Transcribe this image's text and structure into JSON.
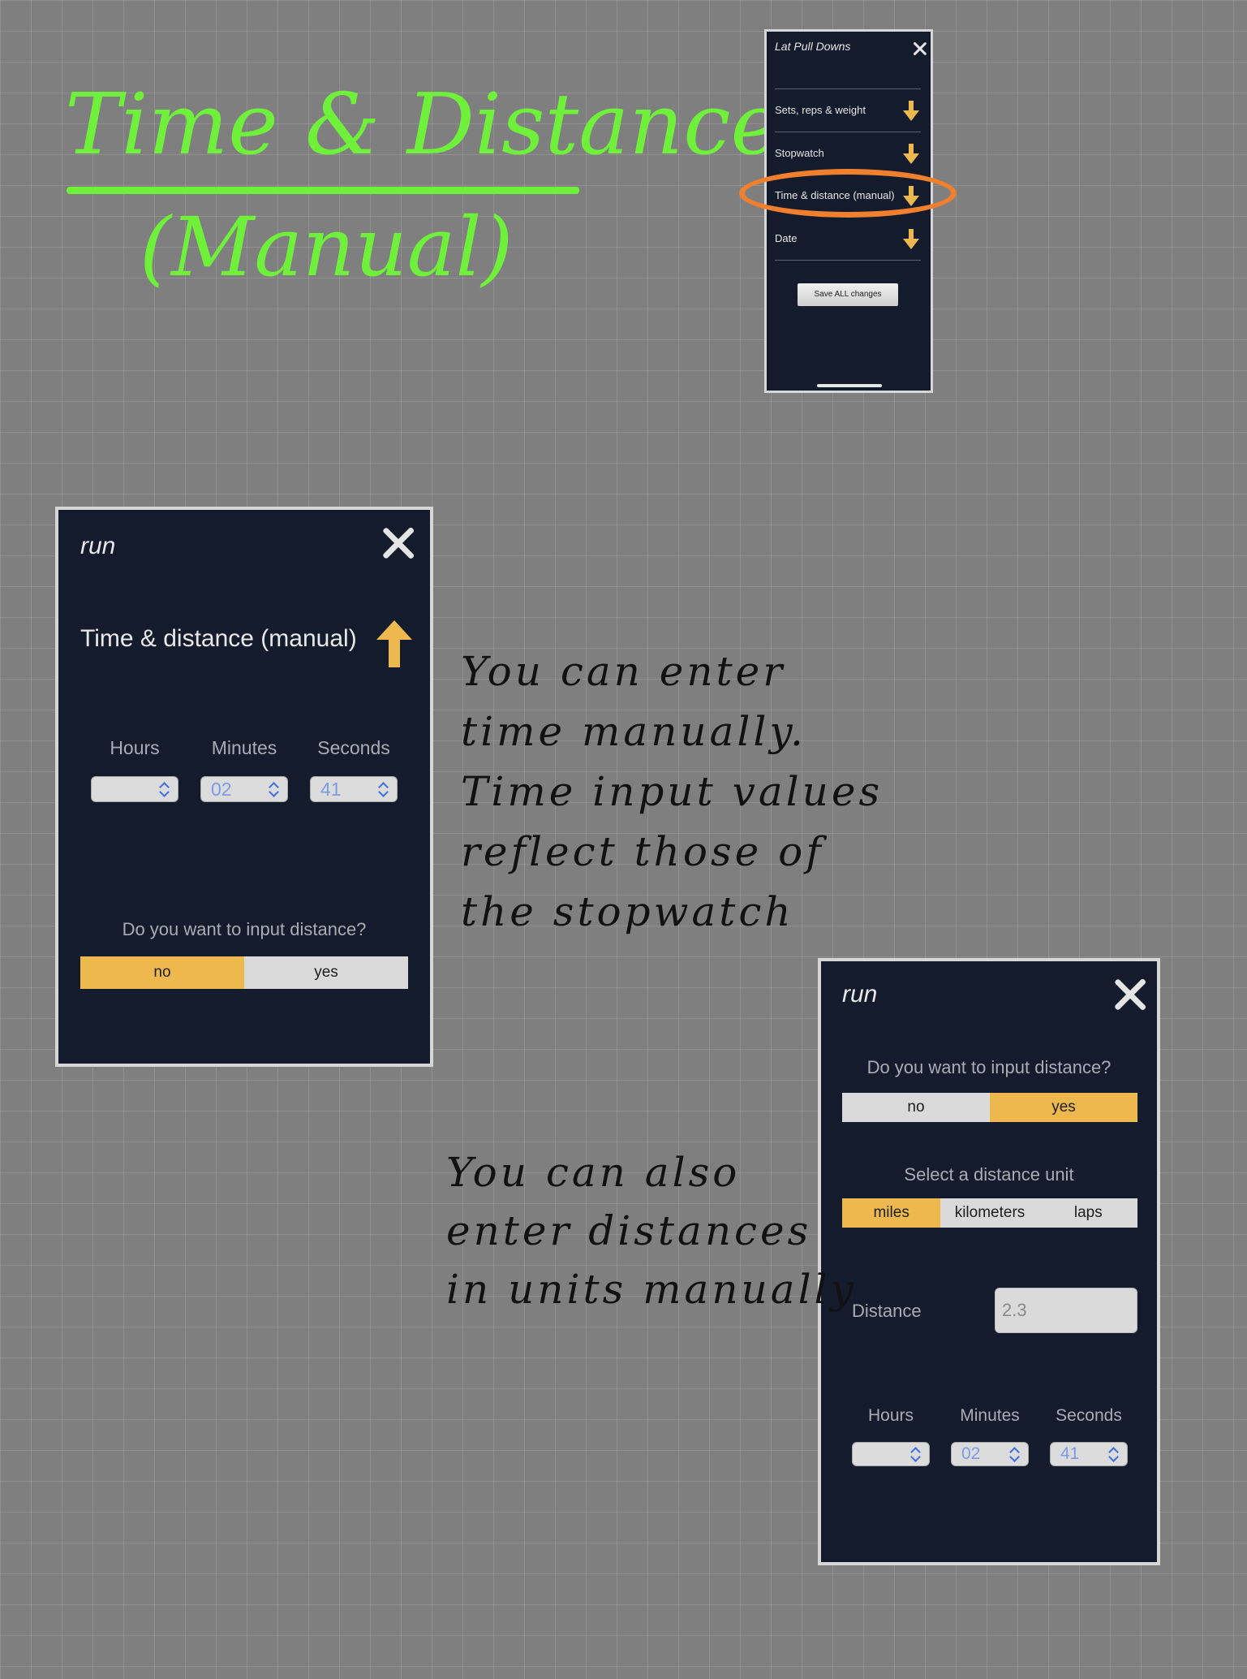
{
  "title": {
    "line1": "Time & Distance",
    "line2": "(Manual)"
  },
  "overview_screen": {
    "title": "Lat Pull Downs",
    "rows": [
      {
        "label": "Sets, reps & weight"
      },
      {
        "label": "Stopwatch"
      },
      {
        "label": "Time & distance (manual)"
      },
      {
        "label": "Date"
      }
    ],
    "save_button": "Save ALL changes"
  },
  "screen_a": {
    "activity": "run",
    "section": "Time & distance (manual)",
    "time_labels": {
      "hours": "Hours",
      "minutes": "Minutes",
      "seconds": "Seconds"
    },
    "time_values": {
      "hours": "",
      "minutes": "02",
      "seconds": "41"
    },
    "distance_question": "Do you want to input distance?",
    "distance_toggle": {
      "no": "no",
      "yes": "yes",
      "selected": "no"
    }
  },
  "screen_b": {
    "activity": "run",
    "distance_question": "Do you want to input distance?",
    "distance_toggle": {
      "no": "no",
      "yes": "yes",
      "selected": "yes"
    },
    "unit_prompt": "Select a distance unit",
    "units": {
      "miles": "miles",
      "kilometers": "kilometers",
      "laps": "laps",
      "selected": "miles"
    },
    "distance_label": "Distance",
    "distance_value": "2.3",
    "time_labels": {
      "hours": "Hours",
      "minutes": "Minutes",
      "seconds": "Seconds"
    },
    "time_values": {
      "hours": "",
      "minutes": "02",
      "seconds": "41"
    }
  },
  "notes": {
    "note1": [
      "You can enter",
      "time manually.",
      "Time input values",
      "reflect those of",
      "the stopwatch"
    ],
    "note2": [
      "You can also",
      "enter distances",
      "in units manually"
    ]
  },
  "colors": {
    "accent_yellow": "#edb94f",
    "highlight_orange": "#f07f2e",
    "title_green": "#6ff03a",
    "screen_bg": "#141b2c"
  }
}
